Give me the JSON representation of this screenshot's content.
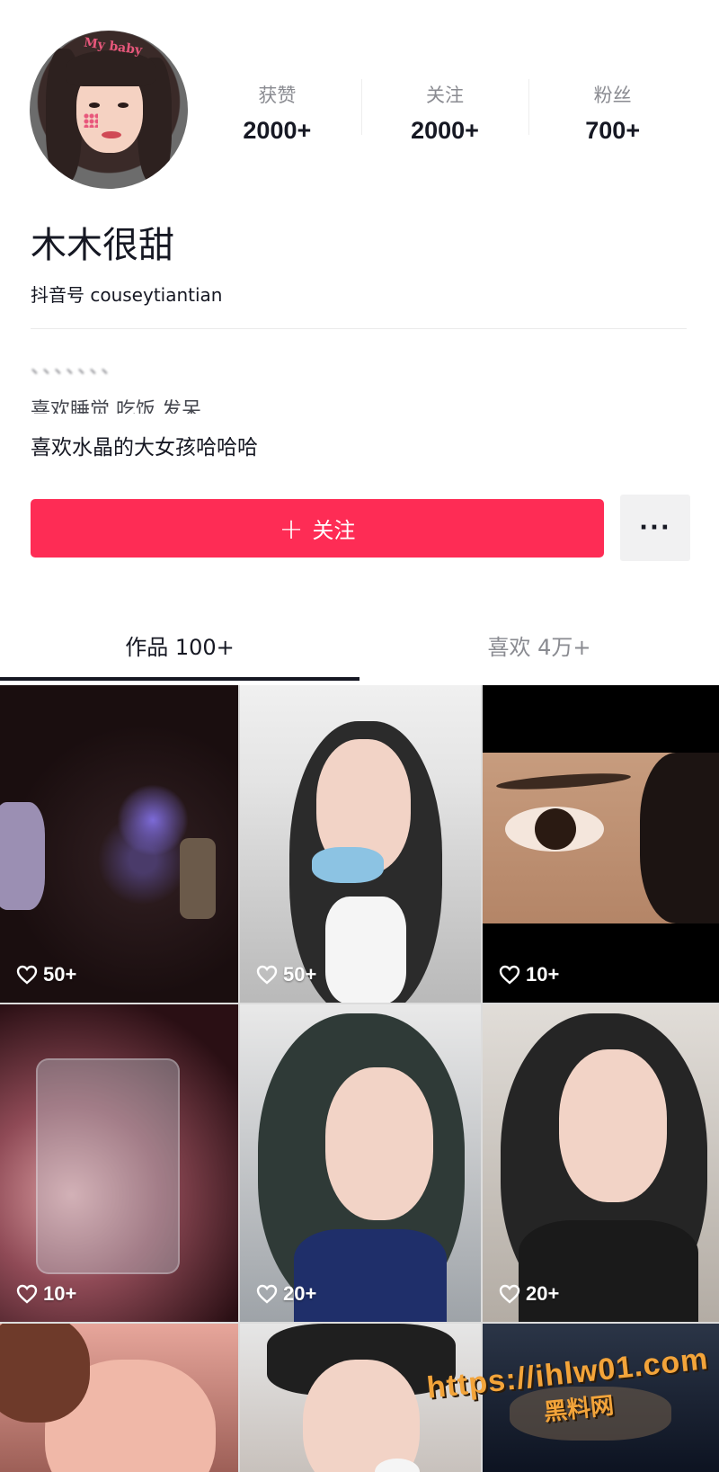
{
  "profile": {
    "nickname": "木木很甜",
    "douyin_id": "抖音号 couseytiantian",
    "stats": [
      {
        "label": "获赞",
        "value": "2000+"
      },
      {
        "label": "关注",
        "value": "2000+"
      },
      {
        "label": "粉丝",
        "value": "700+"
      }
    ],
    "bio": {
      "line1": "、、、、、、、",
      "line2": "喜欢睡觉 吃饭 发呆",
      "line3": "喜欢水晶的大女孩哈哈哈"
    },
    "follow_label": "关注",
    "follow_plus": "+",
    "more_label": "···",
    "avatar_sticker": "My baby"
  },
  "tabs": [
    {
      "label": "作品 100+",
      "active": true
    },
    {
      "label": "喜欢 4万+",
      "active": false
    }
  ],
  "videos": [
    {
      "likes": "50+"
    },
    {
      "likes": "50+"
    },
    {
      "likes": "10+"
    },
    {
      "likes": "10+"
    },
    {
      "likes": "20+"
    },
    {
      "likes": "20+"
    },
    {
      "likes": ""
    },
    {
      "likes": ""
    },
    {
      "likes": ""
    }
  ],
  "watermark": {
    "url": "https://ihlw01.com",
    "name": "黑料网"
  },
  "colors": {
    "follow_button": "#fe2c55",
    "more_button": "#f1f1f2",
    "text_primary": "#161823",
    "text_secondary": "#8a8b91",
    "watermark": "#f3a43a"
  }
}
